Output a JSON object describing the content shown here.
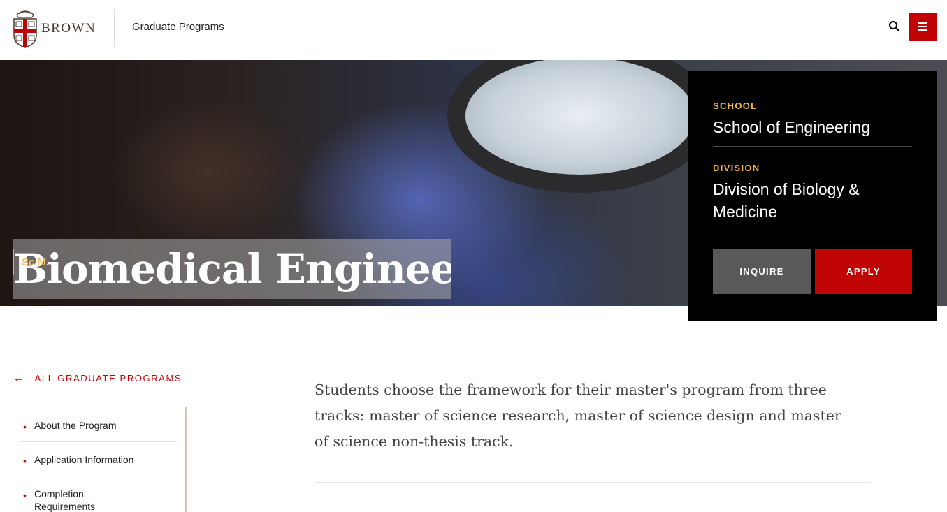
{
  "header": {
    "wordmark": "BROWN",
    "site_title": "Graduate Programs",
    "brand_red": "#c00404",
    "icons": {
      "logo": "brown-shield-icon",
      "search": "search-icon",
      "menu": "hamburger-menu-icon"
    }
  },
  "hero": {
    "program_title": "Biomedical Engineering",
    "degree": "Sc.M."
  },
  "info_panel": {
    "school_label": "SCHOOL",
    "school_value": "School of Engineering",
    "division_label": "DIVISION",
    "division_value": "Division of Biology & Medicine",
    "inquire_label": "INQUIRE",
    "apply_label": "APPLY",
    "label_color": "#f2b446"
  },
  "sidebar": {
    "back_label": "ALL GRADUATE PROGRAMS",
    "back_icon": "arrow-left-icon",
    "items": [
      {
        "label": "About the Program"
      },
      {
        "label": "Application Information"
      },
      {
        "label": "Completion Requirements"
      }
    ]
  },
  "main": {
    "intro": "Students choose the framework for their master's program from three tracks: master of science research, master of science design and master of science non-thesis track."
  }
}
